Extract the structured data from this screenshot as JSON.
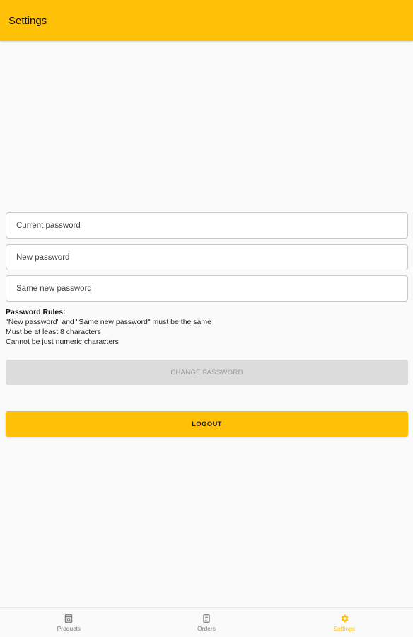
{
  "app_bar": {
    "title": "Settings"
  },
  "form": {
    "current_password": {
      "placeholder": "Current password",
      "value": ""
    },
    "new_password": {
      "placeholder": "New password",
      "value": ""
    },
    "same_new_password": {
      "placeholder": "Same new password",
      "value": ""
    }
  },
  "rules": {
    "title": "Password Rules:",
    "items": [
      "\"New password\" and \"Same new password\" must be the same",
      "Must be at least 8 characters",
      "Cannot be just numeric characters"
    ]
  },
  "buttons": {
    "change_password": "CHANGE PASSWORD",
    "logout": "LOGOUT"
  },
  "bottom_nav": {
    "items": [
      {
        "label": "Products",
        "icon": "products-icon",
        "active": false
      },
      {
        "label": "Orders",
        "icon": "orders-icon",
        "active": false
      },
      {
        "label": "Settings",
        "icon": "gear-icon",
        "active": true
      }
    ]
  },
  "colors": {
    "primary": "#ffc107",
    "disabled_button": "#dcdcdc",
    "background": "#fafafa"
  }
}
